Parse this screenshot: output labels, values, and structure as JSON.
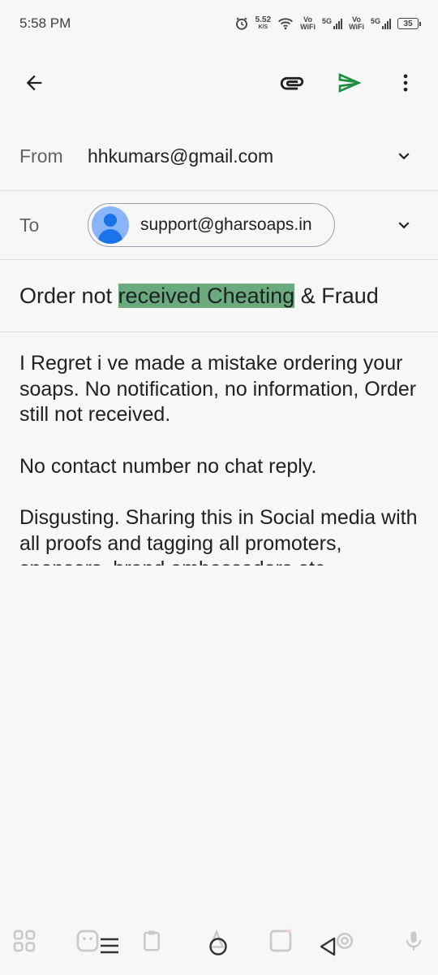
{
  "status_bar": {
    "time": "5:58 PM",
    "speed_value": "5.52",
    "speed_unit": "K/S",
    "vo_label_1": "Vo",
    "wifi_label_1": "WiFi",
    "net_1": "5G",
    "vo_label_2": "Vo",
    "wifi_label_2": "WiFi",
    "net_2": "5G",
    "battery": "35"
  },
  "compose": {
    "from_label": "From",
    "from_value": "hhkumars@gmail.com",
    "to_label": "To",
    "to_chip": "support@gharsoaps.in",
    "subject_before": "Order not ",
    "subject_highlight": "received Cheating",
    "subject_after": " & Fraud",
    "body": [
      "I Regret i ve made a mistake ordering your soaps. No notification, no information, Order still not received.",
      "No contact number no chat reply.",
      "Disgusting. Sharing this in Social media with all proofs and tagging all promoters, sponsors, brand ambassadors etc."
    ]
  },
  "colors": {
    "send_icon": "#1e8e3e",
    "highlight": "#6aab7e",
    "avatar_bg": "#8ab4f8",
    "avatar_fg": "#1a73e8"
  }
}
